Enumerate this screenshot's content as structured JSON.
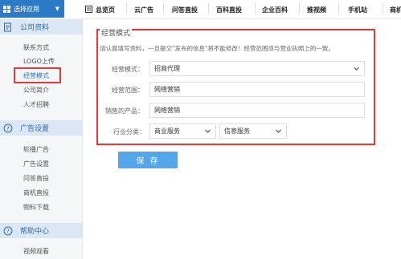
{
  "app_select": {
    "label": "选择应用"
  },
  "topnav": {
    "tabs": [
      {
        "label": "总览页"
      },
      {
        "label": "云广告"
      },
      {
        "label": "问答直投"
      },
      {
        "label": "百科直投"
      },
      {
        "label": "企业百科"
      },
      {
        "label": "推视频"
      },
      {
        "label": "手机站"
      },
      {
        "label": "商机"
      }
    ]
  },
  "sidebar": {
    "sections": [
      {
        "title": "公司资料",
        "items": [
          "联系方式",
          "LOGO上传",
          "经营模式",
          "公司简介",
          "人才招聘"
        ]
      },
      {
        "title": "广告设置",
        "items": [
          "轮播广告",
          "广告设置",
          "问答直投",
          "商机直投",
          "物料下载"
        ]
      },
      {
        "title": "帮助中心",
        "items": [
          "视频观看"
        ]
      }
    ],
    "active_item": "经营模式"
  },
  "form": {
    "title": "经营模式",
    "note": "请认真填写资料，一旦提交\"发布的信息\"将不能修改！经营范围须与营业执照上的一致。",
    "business_mode_label": "经营模式：",
    "business_mode_value": "招商代理",
    "business_scope_label": "经营范围：",
    "business_scope_value": "网络营销",
    "products_label": "销售的产品：",
    "products_value": "网络营销",
    "industry_label": "行业分类：",
    "industry_primary": "商业服务",
    "industry_secondary": "信息服务"
  },
  "save_label": "保 存",
  "colors": {
    "primary": "#2a7ac5",
    "button": "#53a6e8",
    "highlight": "#e53935",
    "section_bg": "#dbe7f5"
  }
}
